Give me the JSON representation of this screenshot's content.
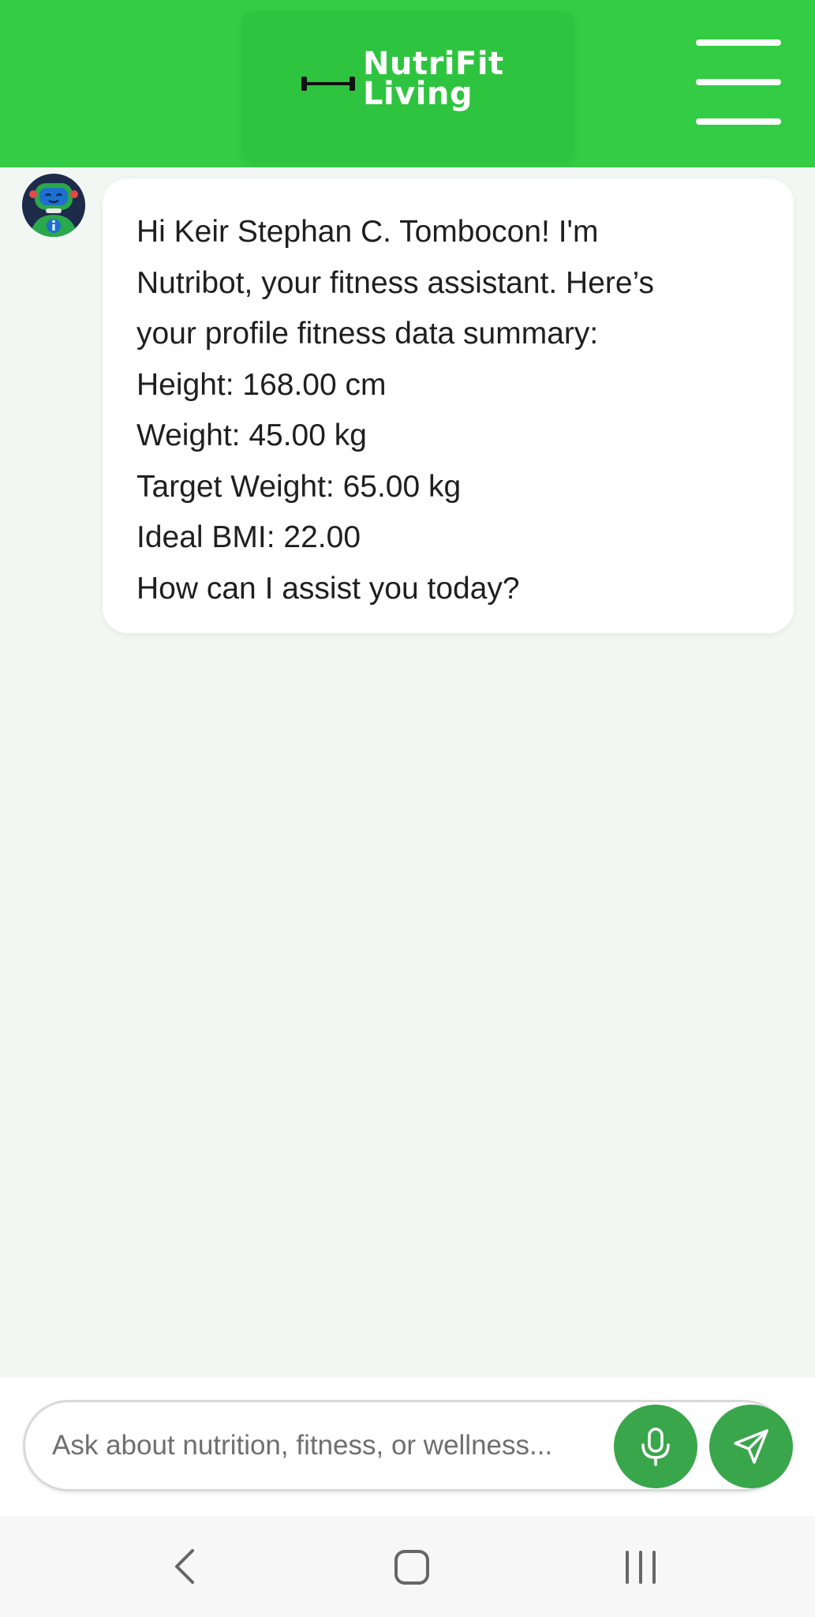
{
  "header": {
    "logo_line1": "NutriFit",
    "logo_line2": "Living",
    "logo_icon": "dumbbell-icon",
    "menu_icon": "hamburger-menu-icon",
    "color": "#33cc44"
  },
  "chat": {
    "bot_avatar_icon": "robot-avatar",
    "messages": [
      {
        "sender": "bot",
        "lines": [
          "Hi Keir Stephan C. Tombocon! I'm",
          "Nutribot, your fitness assistant. Here’s",
          "your profile fitness data summary:",
          "Height: 168.00 cm",
          "Weight: 45.00 kg",
          "Target Weight: 65.00 kg",
          "Ideal BMI: 22.00",
          "How can I assist you today?"
        ]
      }
    ]
  },
  "composer": {
    "placeholder": "Ask about nutrition, fitness, or wellness...",
    "value": "",
    "mic_icon": "microphone-icon",
    "send_icon": "send-icon",
    "button_color": "#3aa64c"
  },
  "system_nav": {
    "back_icon": "back-chevron-icon",
    "home_icon": "home-square-icon",
    "recents_icon": "recents-icon"
  }
}
